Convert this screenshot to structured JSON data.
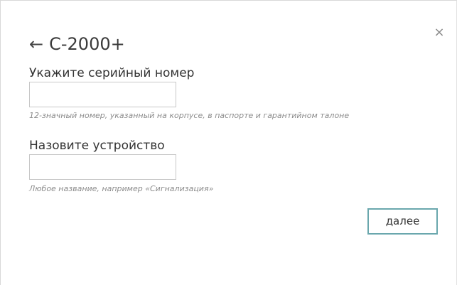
{
  "header": {
    "back_icon": "←",
    "title": "С-2000+",
    "close_icon": "×"
  },
  "serial": {
    "label": "Укажите серийный номер",
    "value": "",
    "hint": "12-значный номер, указанный на корпусе, в паспорте и гарантийном талоне"
  },
  "device_name": {
    "label": "Назовите устройство",
    "value": "",
    "hint": "Любое название, например «Сигнализация»"
  },
  "actions": {
    "next_label": "далее"
  }
}
